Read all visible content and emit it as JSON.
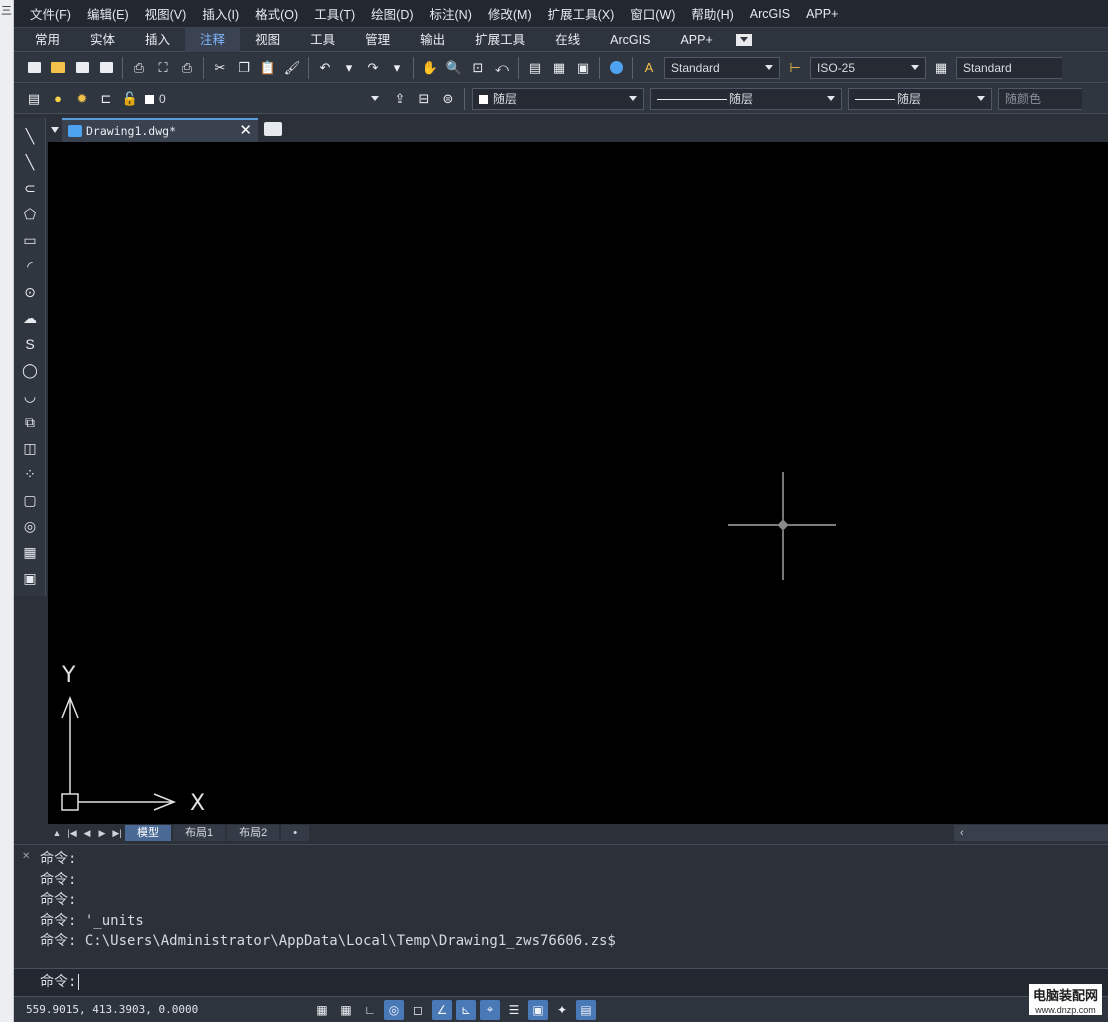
{
  "menubar": [
    "文件(F)",
    "编辑(E)",
    "视图(V)",
    "插入(I)",
    "格式(O)",
    "工具(T)",
    "绘图(D)",
    "标注(N)",
    "修改(M)",
    "扩展工具(X)",
    "窗口(W)",
    "帮助(H)",
    "ArcGIS",
    "APP+"
  ],
  "ribbon_tabs": [
    "常用",
    "实体",
    "插入",
    "注释",
    "视图",
    "工具",
    "管理",
    "输出",
    "扩展工具",
    "在线",
    "ArcGIS",
    "APP+"
  ],
  "ribbon_active_tab": "注释",
  "toolbar1": {
    "text_style": "Standard",
    "dim_style": "ISO-25",
    "table_style": "Standard"
  },
  "toolbar2": {
    "layer": "0",
    "color": "随层",
    "linetype": "随层",
    "lineweight": "随层",
    "plotstyle": "随颜色"
  },
  "document": {
    "tab_title": "Drawing1.dwg*"
  },
  "canvas": {
    "ucs_x_label": "X",
    "ucs_y_label": "Y"
  },
  "layout_tabs": [
    "模型",
    "布局1",
    "布局2"
  ],
  "layout_active": "模型",
  "layout_add": "•",
  "hscroll_arrow": "‹",
  "command": {
    "history": [
      "命令:",
      "命令:",
      "命令:",
      "命令: '_units",
      "命令: C:\\Users\\Administrator\\AppData\\Local\\Temp\\Drawing1_zws76606.zs$"
    ],
    "prompt": "命令:"
  },
  "status": {
    "coordinates": "559.9015, 413.3903, 0.0000"
  },
  "watermark": {
    "name": "电脑装配网",
    "url": "www.dnzp.com"
  },
  "colors": {
    "canvas_bg": "#000000",
    "chrome_bg": "#2b3039",
    "accent": "#4a79b8",
    "crosshair": "#c8c8c8"
  }
}
